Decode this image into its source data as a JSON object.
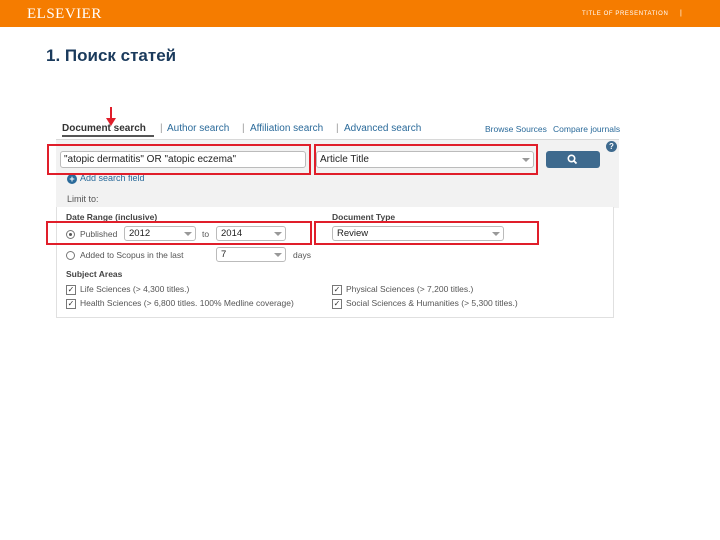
{
  "header": {
    "logo": "ELSEVIER",
    "presentation_title": "TITLE OF PRESENTATION",
    "separator": "|"
  },
  "slide": {
    "heading": "1.  Поиск статей"
  },
  "search": {
    "tabs": [
      "Document search",
      "Author search",
      "Affiliation search",
      "Advanced search"
    ],
    "active_tab": "Document search",
    "right_links": [
      "Browse Sources",
      "Compare journals"
    ],
    "query": "\"atopic dermatitis\" OR \"atopic eczema\"",
    "field": "Article Title",
    "help": "?",
    "add_field": "Add search field",
    "limit_to": "Limit to:"
  },
  "filters": {
    "date_range_label": "Date Range (inclusive)",
    "published_label": "Published",
    "from_year": "2012",
    "to_label": "to",
    "to_year": "2014",
    "added_label": "Added to Scopus in the last",
    "days_value": "7",
    "days_label": "days",
    "document_type_label": "Document Type",
    "document_type": "Review",
    "subject_areas_label": "Subject Areas",
    "subjects": [
      "Life Sciences (> 4,300 titles.)",
      "Health Sciences (> 6,800 titles. 100% Medline coverage)",
      "Physical Sciences (> 7,200 titles.)",
      "Social Sciences & Humanities (> 5,300 titles.)"
    ]
  },
  "colors": {
    "brand_orange": "#f57c00",
    "highlight_red": "#e01e2a",
    "link_blue": "#2a6a9a"
  }
}
